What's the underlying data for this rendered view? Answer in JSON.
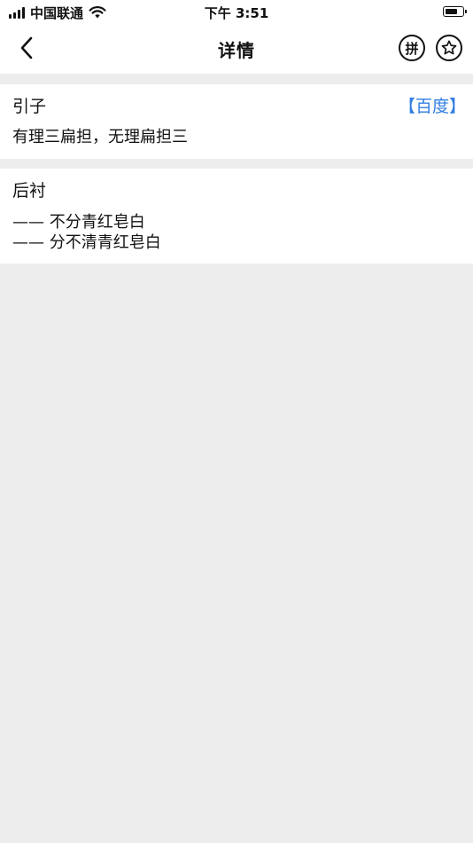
{
  "status_bar": {
    "carrier": "中国联通",
    "time": "下午 3:51"
  },
  "nav": {
    "title": "详情",
    "pinyin_button_label": "拼"
  },
  "sections": [
    {
      "heading": "引子",
      "link_label": "【百度】",
      "body": "有理三扁担，无理扁担三"
    },
    {
      "heading": "后衬",
      "lines": [
        "—— 不分青红皂白",
        "—— 分不清青红皂白"
      ]
    }
  ],
  "colors": {
    "accent": "#2f7de1",
    "background": "#ededed",
    "surface": "#ffffff"
  },
  "icons": {
    "back": "chevron-left-icon",
    "star": "star-icon",
    "wifi": "wifi-icon",
    "battery": "battery-icon",
    "signal": "signal-icon"
  }
}
